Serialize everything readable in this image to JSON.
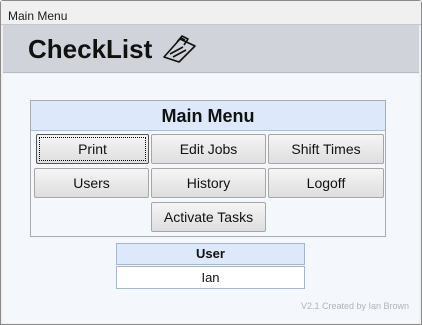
{
  "window": {
    "title": "Main Menu"
  },
  "header": {
    "app_title": "CheckList",
    "icon": "clipboard-icon"
  },
  "menu": {
    "title": "Main Menu",
    "buttons": {
      "print": "Print",
      "edit_jobs": "Edit Jobs",
      "shift_times": "Shift Times",
      "users": "Users",
      "history": "History",
      "logoff": "Logoff",
      "activate_tasks": "Activate Tasks"
    }
  },
  "user_panel": {
    "label": "User",
    "value": "Ian"
  },
  "footer": {
    "credit": "V2.1 Created by Ian Brown"
  },
  "colors": {
    "header_band": "#d0d3d9",
    "menu_header": "#dde8fb",
    "body_bg": "#f4f7fc"
  }
}
